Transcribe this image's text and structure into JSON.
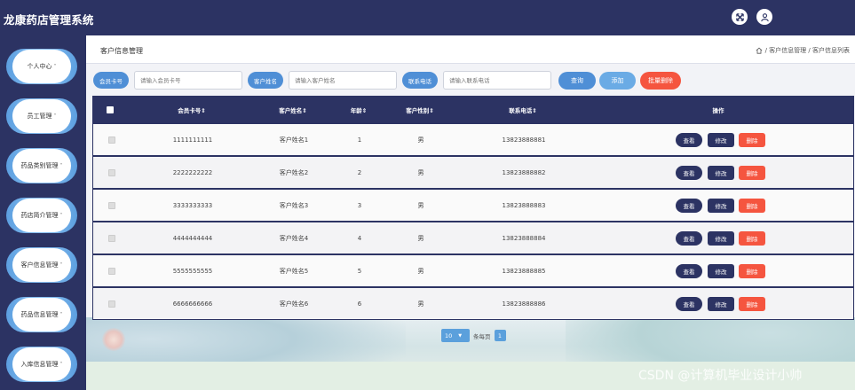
{
  "app": {
    "title": "龙康药店管理系统"
  },
  "sidebar": {
    "items": [
      {
        "label": "个人中心"
      },
      {
        "label": "员工管理"
      },
      {
        "label": "药品类别管理"
      },
      {
        "label": "药店简介管理"
      },
      {
        "label": "客户信息管理"
      },
      {
        "label": "药品信息管理"
      },
      {
        "label": "入库信息管理"
      }
    ]
  },
  "breadcrumb": {
    "title": "客户信息管理",
    "path": "/ 客户信息管理 / 客户信息列表"
  },
  "search": {
    "card_label": "会员卡号",
    "card_placeholder": "请输入会员卡号",
    "name_label": "客户姓名",
    "name_placeholder": "请输入客户姓名",
    "phone_label": "联系电话",
    "phone_placeholder": "请输入联系电话",
    "query_btn": "查询",
    "add_btn": "添加",
    "batch_delete_btn": "批量删除"
  },
  "table": {
    "headers": {
      "card": "会员卡号⇕",
      "name": "客户姓名⇕",
      "age": "年龄⇕",
      "gender": "客户性别⇕",
      "phone": "联系电话⇕",
      "ops": "操作"
    },
    "rows": [
      {
        "card": "1111111111",
        "name": "客户姓名1",
        "age": "1",
        "gender": "男",
        "phone": "13823888881"
      },
      {
        "card": "2222222222",
        "name": "客户姓名2",
        "age": "2",
        "gender": "男",
        "phone": "13823888882"
      },
      {
        "card": "3333333333",
        "name": "客户姓名3",
        "age": "3",
        "gender": "男",
        "phone": "13823888883"
      },
      {
        "card": "4444444444",
        "name": "客户姓名4",
        "age": "4",
        "gender": "男",
        "phone": "13823888884"
      },
      {
        "card": "5555555555",
        "name": "客户姓名5",
        "age": "5",
        "gender": "男",
        "phone": "13823888885"
      },
      {
        "card": "6666666666",
        "name": "客户姓名6",
        "age": "6",
        "gender": "男",
        "phone": "13823888886"
      }
    ],
    "view_label": "查看",
    "edit_label": "修改",
    "delete_label": "删除"
  },
  "pager": {
    "size": "10",
    "per_page": "条每页",
    "current": "1"
  },
  "watermark": "CSDN @计算机毕业设计小帅",
  "colors": {
    "nav": "#2c3363",
    "accent": "#4f8fd6",
    "danger": "#f5553f"
  },
  "icons": {
    "fullscreen": "fullscreen-icon",
    "user": "user-icon",
    "home": "home-icon"
  }
}
